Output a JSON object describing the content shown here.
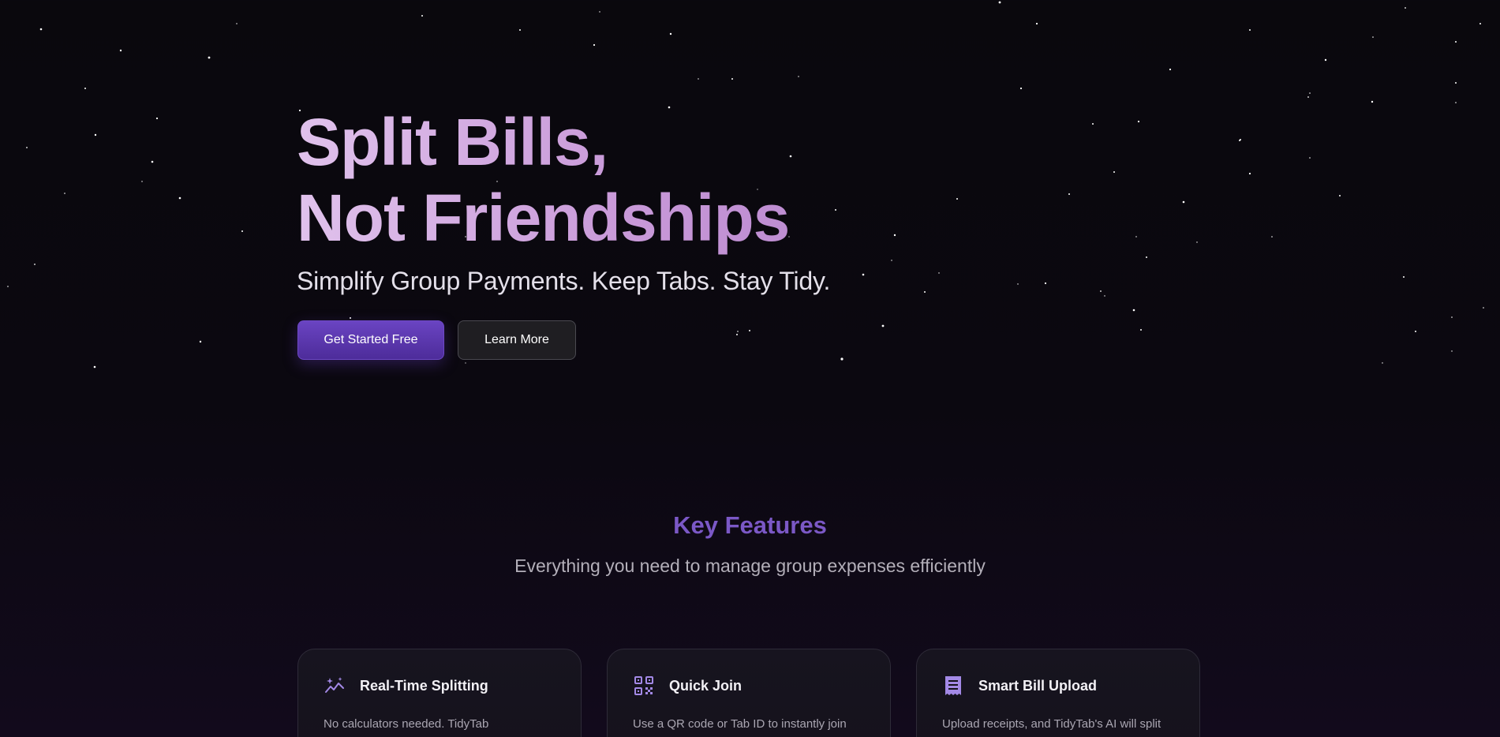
{
  "hero": {
    "title_line1": "Split Bills,",
    "title_line2": "Not Friendships",
    "subtitle": "Simplify Group Payments. Keep Tabs. Stay Tidy.",
    "primary_button": "Get Started Free",
    "secondary_button": "Learn More"
  },
  "features": {
    "heading": "Key Features",
    "subheading": "Everything you need to manage group expenses efficiently",
    "cards": [
      {
        "icon": "sparkle-chart-icon",
        "title": "Real-Time Splitting",
        "description": "No calculators needed. TidyTab"
      },
      {
        "icon": "qr-code-icon",
        "title": "Quick Join",
        "description": "Use a QR code or Tab ID to instantly join"
      },
      {
        "icon": "receipt-icon",
        "title": "Smart Bill Upload",
        "description": "Upload receipts, and TidyTab's AI will split"
      }
    ]
  },
  "colors": {
    "accent": "#6a44c2",
    "heading_purple": "#7b58c6",
    "title_gradient_start": "#e0c2ec",
    "title_gradient_end": "#bb8ad0",
    "icon_purple": "#a389e6"
  }
}
